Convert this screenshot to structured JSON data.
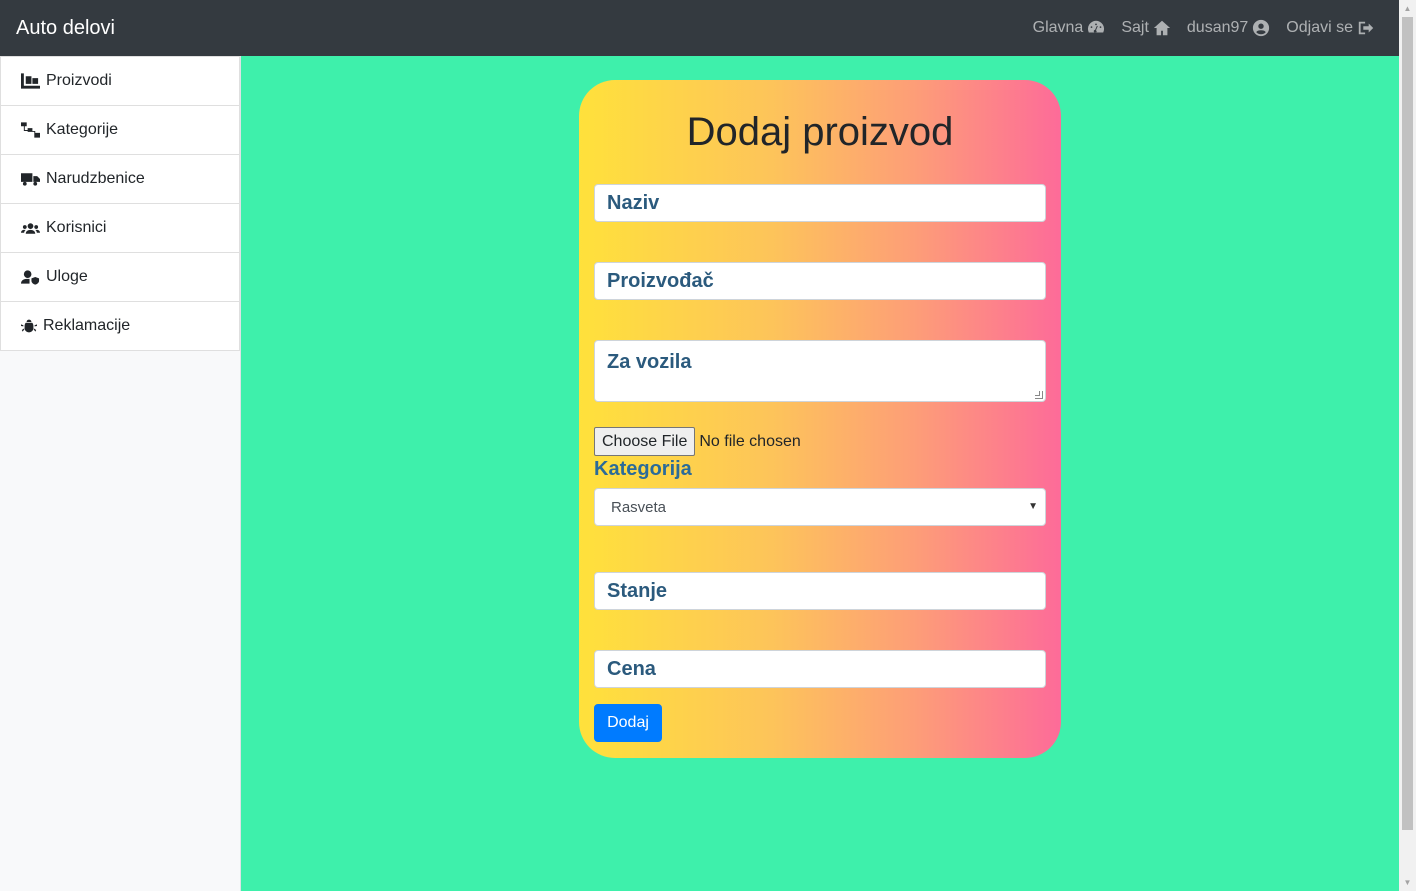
{
  "navbar": {
    "brand": "Auto delovi",
    "links": [
      {
        "label": "Glavna",
        "icon": "dashboard-icon"
      },
      {
        "label": "Sajt",
        "icon": "home-icon"
      },
      {
        "label": "dusan97",
        "icon": "user-circle-icon"
      },
      {
        "label": "Odjavi se",
        "icon": "sign-out-icon"
      }
    ]
  },
  "sidebar": {
    "items": [
      {
        "label": "Proizvodi",
        "icon": "pallet-icon"
      },
      {
        "label": "Kategorije",
        "icon": "sitemap-icon"
      },
      {
        "label": "Narudzbenice",
        "icon": "truck-icon"
      },
      {
        "label": "Korisnici",
        "icon": "users-icon"
      },
      {
        "label": "Uloge",
        "icon": "user-shield-icon"
      },
      {
        "label": "Reklamacije",
        "icon": "bug-icon"
      }
    ]
  },
  "form": {
    "title": "Dodaj proizvod",
    "naziv_placeholder": "Naziv",
    "proizvodjac_placeholder": "Proizvođač",
    "za_vozila_placeholder": "Za vozila",
    "file_button": "Choose File",
    "file_status": "No file chosen",
    "kategorija_label": "Kategorija",
    "kategorija_selected": "Rasveta",
    "stanje_placeholder": "Stanje",
    "cena_placeholder": "Cena",
    "submit_label": "Dodaj"
  },
  "colors": {
    "navbar_bg": "#343a40",
    "main_bg": "#3ef0ab",
    "gradient_start": "#ffe13b",
    "gradient_end": "#fd6b99",
    "primary": "#007bff"
  }
}
